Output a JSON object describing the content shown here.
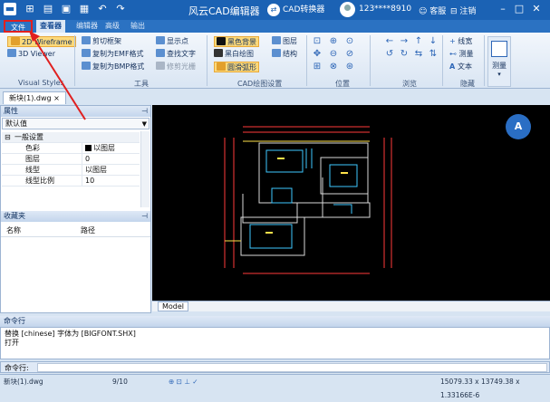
{
  "titlebar": {
    "title": "风云CAD编辑器",
    "converter": "CAD转换器",
    "user": "123****8910",
    "service": "客服",
    "logout": "注销",
    "quick_icons": [
      "folder-icon",
      "new-file-icon",
      "open-file-icon",
      "save-icon",
      "undo-icon",
      "redo-icon"
    ]
  },
  "menu": {
    "tabs": [
      "文件",
      "查看器",
      "编辑器",
      "高级",
      "输出"
    ]
  },
  "ribbon": {
    "viewstyles": {
      "btn_wire": "2D Wireframe",
      "btn_3d": "3D Viewer",
      "group": "Visual Styles"
    },
    "tools": {
      "items": [
        "剪切框架",
        "复制为EMF格式",
        "复制为BMP格式",
        "显示点",
        "查找文字",
        "修剪光栅"
      ],
      "group": "工具"
    },
    "cadsettings": {
      "items": [
        "黑色背景",
        "黑白绘图",
        "圆滑弧形",
        "图层",
        "结构"
      ],
      "group": "CAD绘图设置"
    },
    "position": {
      "group": "位置"
    },
    "browse": {
      "group": "浏览"
    },
    "hide": {
      "items": [
        "线宽",
        "测量",
        "文本"
      ],
      "group": "隐藏"
    },
    "measure": {
      "label": "测量"
    }
  },
  "document": {
    "tab": "新块(1).dwg"
  },
  "properties": {
    "title": "属性",
    "combo": "默认值",
    "section": "一般设置",
    "rows": [
      {
        "key": "色彩",
        "value": "以图层"
      },
      {
        "key": "图层",
        "value": "0"
      },
      {
        "key": "线型",
        "value": "以图层"
      },
      {
        "key": "线型比例",
        "value": "10"
      }
    ]
  },
  "favorites": {
    "title": "收藏夹",
    "col_name": "名称",
    "col_path": "路径"
  },
  "model_tab": "Model",
  "command": {
    "title": "命令行",
    "history": [
      "替换 [chinese] 字体为 [BIGFONT.SHX]",
      "打开"
    ],
    "prompt": "命令行:"
  },
  "status": {
    "file": "新块(1).dwg",
    "page": "9/10",
    "coords": "15079.33 x 13749.38 x 1.33166E-6"
  }
}
